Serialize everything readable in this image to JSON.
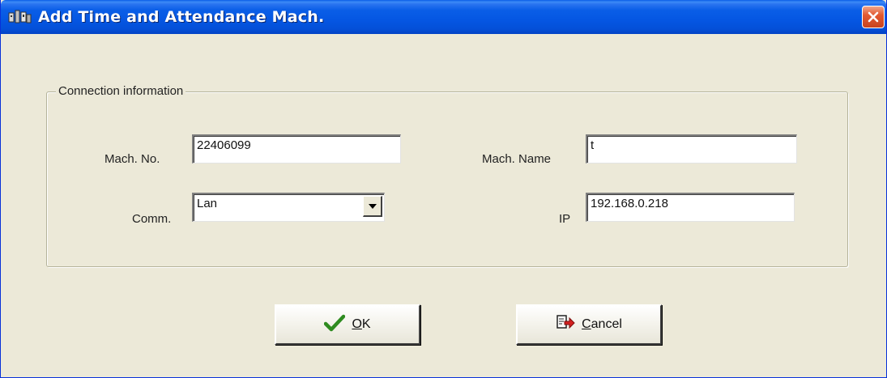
{
  "window": {
    "title": "Add Time and Attendance Mach.",
    "icon": "attendance-machine-icon",
    "close_icon": "close-icon"
  },
  "connection": {
    "legend": "Connection information",
    "mach_no": {
      "label": "Mach. No.",
      "value": "22406099"
    },
    "mach_name": {
      "label": "Mach. Name",
      "value": "t"
    },
    "comm": {
      "label": "Comm.",
      "value": "Lan"
    },
    "ip": {
      "label": "IP",
      "value": "192.168.0.218"
    }
  },
  "buttons": {
    "ok": {
      "label": "OK",
      "icon": "checkmark-icon",
      "icon_color": "#2e8b1f"
    },
    "cancel": {
      "label": "Cancel",
      "icon": "cancel-arrow-icon",
      "icon_color": "#d42020"
    }
  },
  "colors": {
    "titlebar": "#0556e2",
    "window_bg": "#ece9d8",
    "close": "#e35a32"
  }
}
